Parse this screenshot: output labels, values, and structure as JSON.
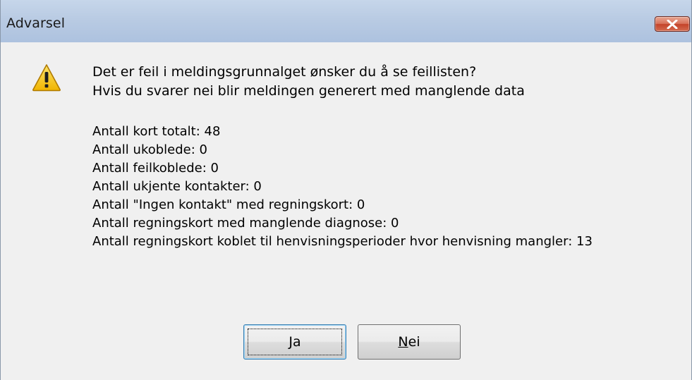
{
  "window": {
    "title": "Advarsel"
  },
  "icon": {
    "name": "warning-icon",
    "color": "#f5c400"
  },
  "message": {
    "lines": [
      "Det er feil i meldingsgrunnalget ønsker du å se feillisten?",
      "Hvis du svarer nei blir meldingen generert med manglende data"
    ]
  },
  "stats": {
    "lines": [
      "Antall kort totalt: 48",
      "Antall ukoblede: 0",
      "Antall feilkoblede: 0",
      "Antall ukjente kontakter:  0",
      "Antall \"Ingen kontakt\" med regningskort: 0",
      "Antall regningskort med manglende diagnose:  0",
      "Antall regningskort koblet til henvisningsperioder hvor henvisning mangler:  13"
    ]
  },
  "buttons": {
    "yes": {
      "mnemonic": "J",
      "rest": "a"
    },
    "no": {
      "mnemonic": "N",
      "rest": "ei"
    }
  }
}
